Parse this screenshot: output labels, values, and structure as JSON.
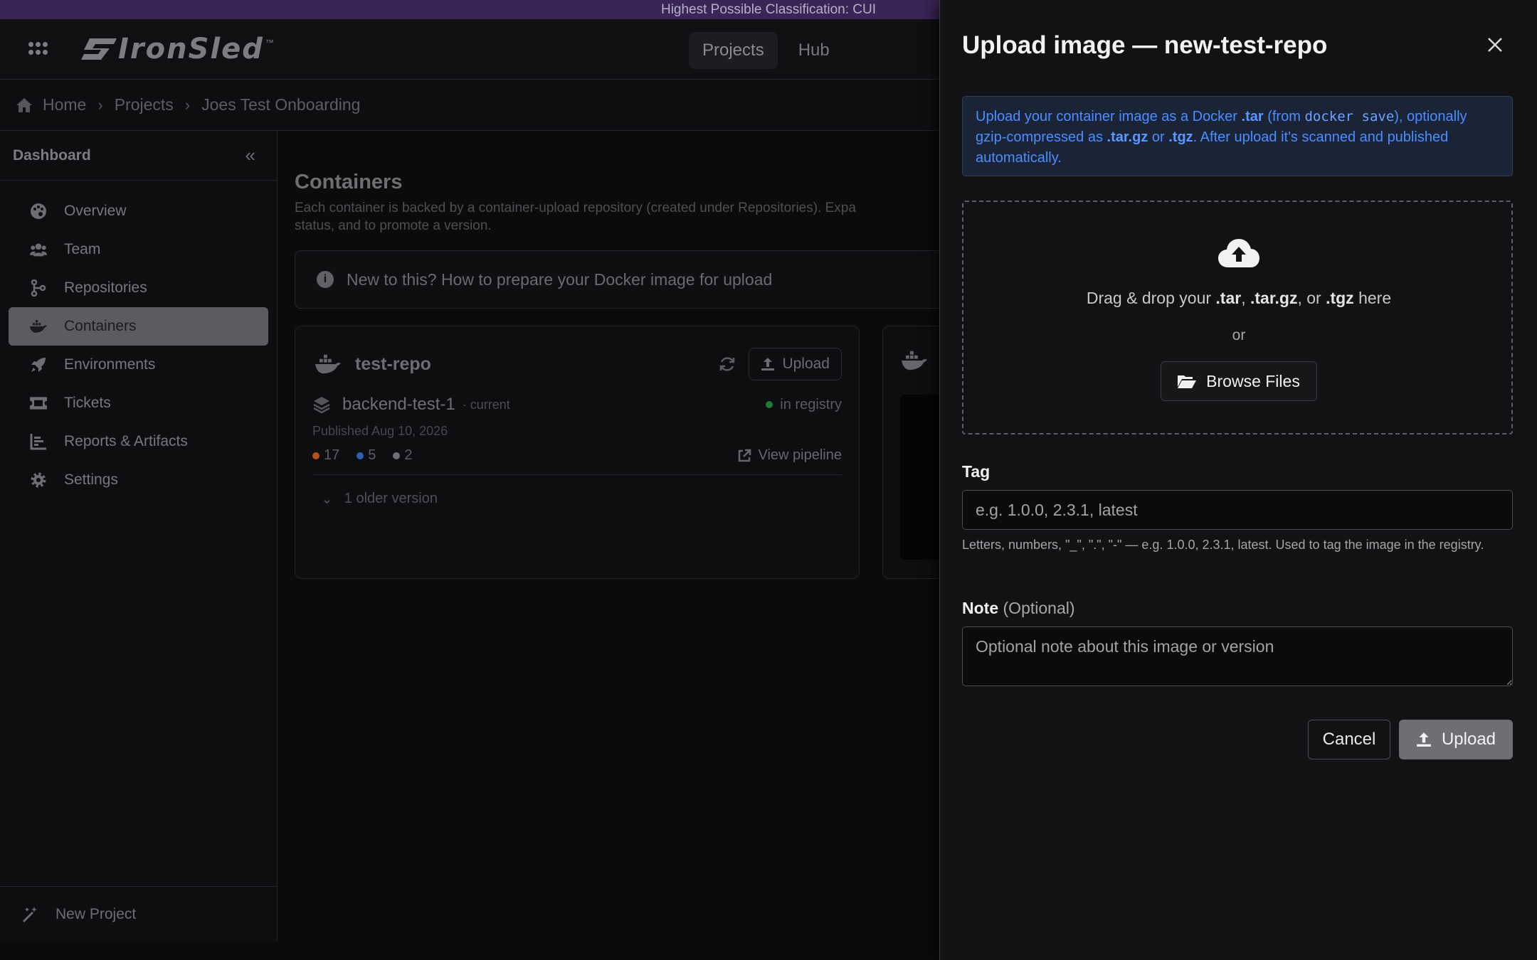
{
  "banner": {
    "text": "Highest Possible Classification: CUI"
  },
  "header": {
    "logo_text": "IronSled",
    "logo_tm": "™",
    "nav": [
      {
        "label": "Projects",
        "active": true
      },
      {
        "label": "Hub",
        "active": false
      }
    ]
  },
  "breadcrumb": [
    "Home",
    "Projects",
    "Joes Test Onboarding"
  ],
  "sidebar": {
    "title": "Dashboard",
    "collapse_icon": "«",
    "items": [
      {
        "label": "Overview",
        "icon": "palette-icon"
      },
      {
        "label": "Team",
        "icon": "users-icon"
      },
      {
        "label": "Repositories",
        "icon": "branch-icon"
      },
      {
        "label": "Containers",
        "icon": "docker-icon",
        "active": true
      },
      {
        "label": "Environments",
        "icon": "rocket-icon"
      },
      {
        "label": "Tickets",
        "icon": "ticket-icon"
      },
      {
        "label": "Reports & Artifacts",
        "icon": "chart-icon"
      },
      {
        "label": "Settings",
        "icon": "gear-icon"
      }
    ],
    "footer": "New Project"
  },
  "main": {
    "title": "Containers",
    "description_1": "Each container is backed by a container-upload repository (created under Repositories). Expa",
    "description_2": "status, and to promote a version.",
    "info": "New to this? How to prepare your Docker image for upload",
    "card": {
      "title": "test-repo",
      "upload_label": "Upload",
      "version": "backend-test-1",
      "version_tag": "· current",
      "status": "in registry",
      "published": "Published Aug 10, 2026",
      "counts": [
        {
          "value": "17",
          "color": "#b4501e"
        },
        {
          "value": "5",
          "color": "#3060b0"
        },
        {
          "value": "2",
          "color": "#707074"
        }
      ],
      "pipeline_label": "View pipeline",
      "older": "1 older version"
    }
  },
  "drawer": {
    "title": "Upload image — new-test-repo",
    "alert": {
      "p1": "Upload your container image as a Docker ",
      "tar": ".tar",
      "p2": " (from ",
      "cmd": "docker save",
      "p3": "), optionally gzip-compressed as ",
      "targz": ".tar.gz",
      "p4": " or ",
      "tgz": ".tgz",
      "p5": ". After upload it's scanned and published automatically."
    },
    "dropzone": {
      "t1": "Drag & drop your ",
      "tar": ".tar",
      "t2": ", ",
      "targz": ".tar.gz",
      "t3": ", or ",
      "tgz": ".tgz",
      "t4": " here",
      "or": "or",
      "browse": "Browse Files"
    },
    "tag": {
      "label": "Tag",
      "placeholder": "e.g. 1.0.0, 2.3.1, latest",
      "hint": "Letters, numbers, \"_\", \".\", \"-\" — e.g. 1.0.0, 2.3.1, latest. Used to tag the image in the registry."
    },
    "note": {
      "label": "Note",
      "optional": "(Optional)",
      "placeholder": "Optional note about this image or version"
    },
    "cancel": "Cancel",
    "upload": "Upload"
  }
}
